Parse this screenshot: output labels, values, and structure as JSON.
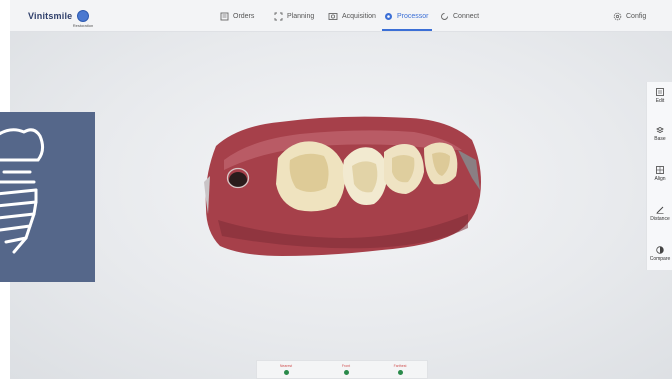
{
  "brand": {
    "name": "Vinitsmile",
    "sub_label": "Restoration"
  },
  "nav": {
    "items": [
      {
        "label": "Orders",
        "icon": "orders-icon"
      },
      {
        "label": "Planning",
        "icon": "planning-icon"
      },
      {
        "label": "Acquisition",
        "icon": "acquisition-icon"
      },
      {
        "label": "Processor",
        "icon": "processor-icon",
        "active": true
      },
      {
        "label": "Connect",
        "icon": "connect-icon"
      }
    ],
    "config_label": "Config"
  },
  "tools": [
    {
      "label": "Edit",
      "icon": "edit-icon"
    },
    {
      "label": "Base",
      "icon": "base-icon"
    },
    {
      "label": "Align",
      "icon": "align-icon"
    },
    {
      "label": "Distance",
      "icon": "distance-icon"
    },
    {
      "label": "Compare",
      "icon": "compare-icon"
    }
  ],
  "bottom_sliders": [
    {
      "label": "Nearest"
    },
    {
      "label": "Front"
    },
    {
      "label": "Farthest"
    }
  ],
  "colors": {
    "accent": "#3b6fd6",
    "overlay": "#55678a",
    "gum": "#a6404a",
    "tooth": "#efe3bf"
  },
  "overlay_icon": "dental-implant-icon"
}
